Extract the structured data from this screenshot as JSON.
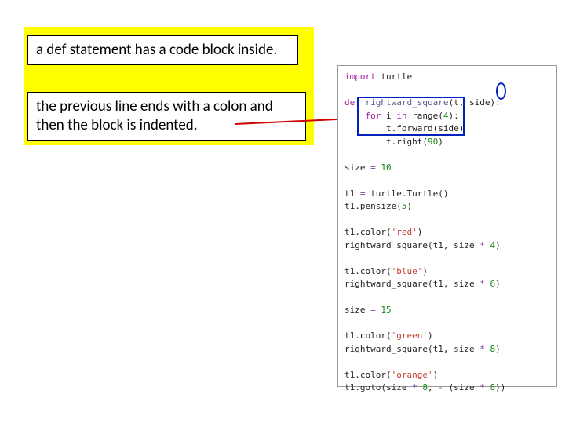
{
  "callouts": {
    "c1": "a def statement has a code block inside.",
    "c2": "the previous line ends with a colon and then the block is indented."
  },
  "code": {
    "l1_kw": "import",
    "l1_mod": " turtle",
    "l2_kw": "def ",
    "l2_fn": "rightward_square",
    "l2_rest": "(t, side):",
    "l3_pre": "    ",
    "l3_kw1": "for",
    "l3_var": " i ",
    "l3_kw2": "in",
    "l3_rng": " range(",
    "l3_num": "4",
    "l3_end": "):",
    "l4": "        t.forward(side)",
    "l5_pre": "        t.right(",
    "l5_num": "90",
    "l5_end": ")",
    "l6_a": "size ",
    "l6_op": "=",
    "l6_b": " ",
    "l6_num": "10",
    "l7_a": "t1 ",
    "l7_op": "=",
    "l7_b": " turtle.Turtle()",
    "l8_a": "t1.pensize(",
    "l8_num": "5",
    "l8_b": ")",
    "l9_a": "t1.color(",
    "l9_str": "'red'",
    "l9_b": ")",
    "l10_a": "rightward_square(t1, size ",
    "l10_op": "*",
    "l10_b": " ",
    "l10_num": "4",
    "l10_c": ")",
    "l11_a": "t1.color(",
    "l11_str": "'blue'",
    "l11_b": ")",
    "l12_a": "rightward_square(t1, size ",
    "l12_op": "*",
    "l12_b": " ",
    "l12_num": "6",
    "l12_c": ")",
    "l13_a": "size ",
    "l13_op": "=",
    "l13_b": " ",
    "l13_num": "15",
    "l14_a": "t1.color(",
    "l14_str": "'green'",
    "l14_b": ")",
    "l15_a": "rightward_square(t1, size ",
    "l15_op": "*",
    "l15_b": " ",
    "l15_num": "8",
    "l15_c": ")",
    "l16_a": "t1.color(",
    "l16_str": "'orange'",
    "l16_b": ")",
    "l17_a": "t1.goto(size ",
    "l17_op1": "*",
    "l17_b": " ",
    "l17_num1": "8",
    "l17_c": ", ",
    "l17_op2": "-",
    "l17_d": " (size ",
    "l17_op3": "*",
    "l17_e": " ",
    "l17_num2": "8",
    "l17_f": "))"
  }
}
